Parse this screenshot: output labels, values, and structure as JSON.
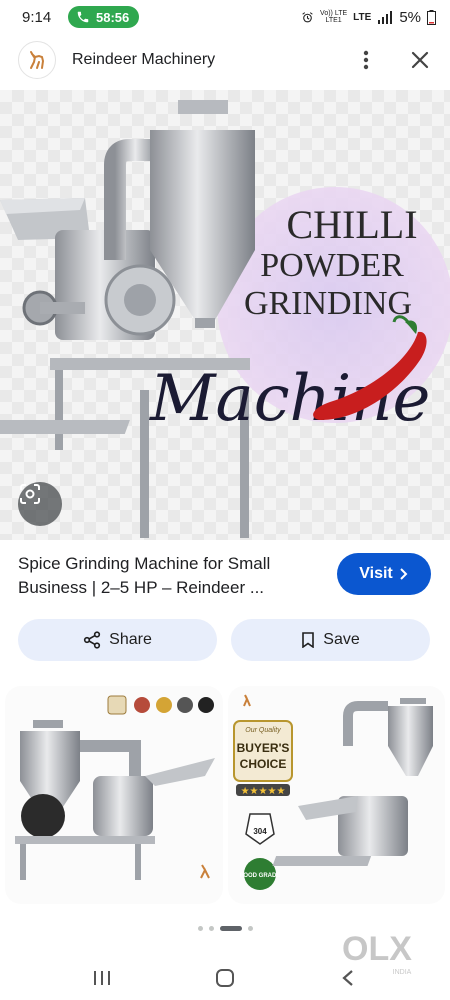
{
  "status_bar": {
    "time": "9:14",
    "call_duration": "58:56",
    "network_top": "Vo)) LTE",
    "network_bottom": "LTE1",
    "signal_label": "LTE",
    "battery": "5%"
  },
  "header": {
    "site_name": "Reindeer Machinery",
    "logo_icon": "reindeer-logo-icon"
  },
  "hero": {
    "headline_line1": "CHILLI",
    "headline_line2": "POWDER",
    "headline_line3": "GRINDING",
    "script_text": "Machine",
    "accent_color": "#c81e1e"
  },
  "result": {
    "title": "Spice Grinding Machine for Small Business | 2–5 HP – Reindeer ...",
    "visit_label": "Visit",
    "share_label": "Share",
    "save_label": "Save"
  },
  "related": [
    {
      "badges": [
        "badge-1",
        "badge-2",
        "badge-3",
        "badge-4",
        "badge-5"
      ]
    },
    {
      "badge_top": "Our Quality",
      "badge_title_1": "BUYER'S",
      "badge_title_2": "CHOICE",
      "stars": "★★★★★",
      "steel_grade": "304",
      "food_grade": "FOOD GRADE"
    }
  ],
  "watermark": {
    "brand": "OLX",
    "country": "INDIA"
  },
  "colors": {
    "visit_button": "#0b57d0",
    "action_button_bg": "#e8eefb",
    "call_pill": "#2fa84f"
  }
}
